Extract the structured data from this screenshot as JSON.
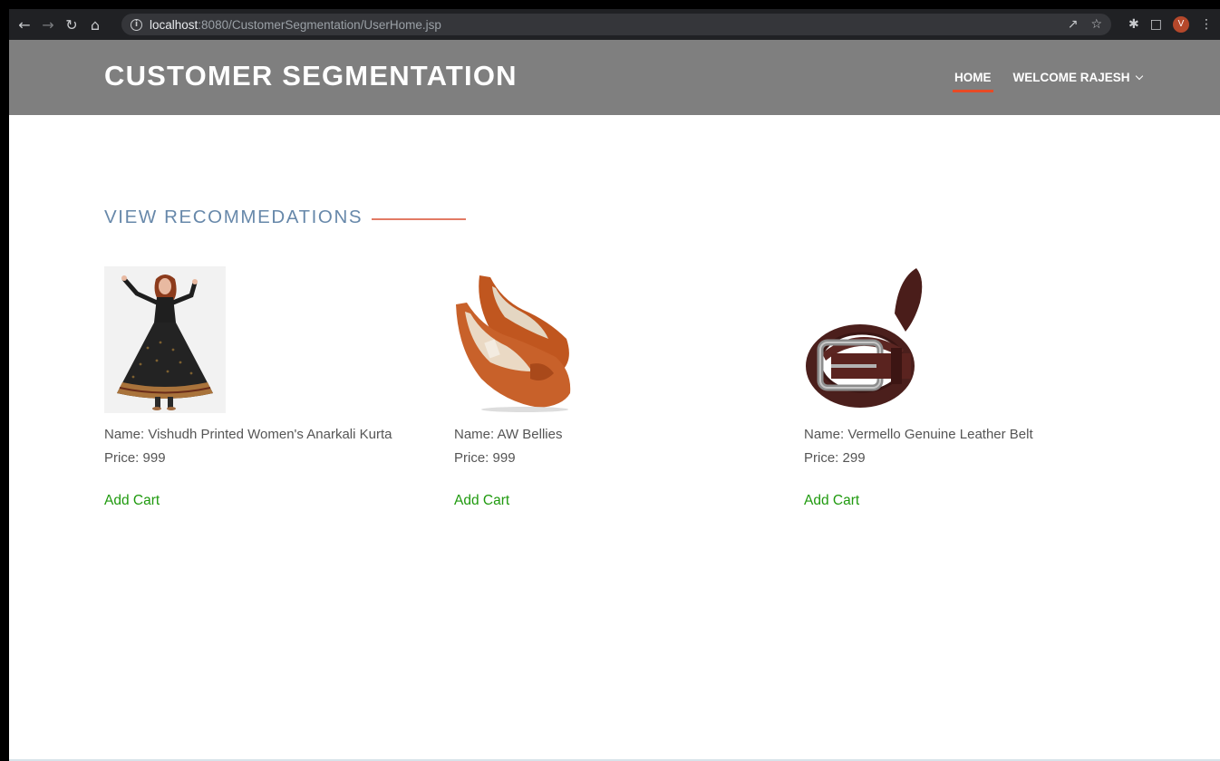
{
  "browser": {
    "url_host": "localhost",
    "url_rest": ":8080/CustomerSegmentation/UserHome.jsp",
    "profile_initial": "V",
    "icons": [
      "back-icon",
      "forward-icon",
      "reload-icon",
      "home-icon",
      "info-icon",
      "share-icon",
      "star-icon",
      "extensions-icon",
      "side-panel-icon",
      "menu-icon"
    ]
  },
  "header": {
    "brand": "CUSTOMER SEGMENTATION",
    "nav": {
      "home": "HOME",
      "welcome": "WELCOME RAJESH"
    },
    "accent_color": "#e84a25",
    "background_color": "#7f7f7f"
  },
  "main": {
    "section_title": "VIEW RECOMMEDATIONS",
    "products": [
      {
        "name": "Name: Vishudh Printed Women's Anarkali Kurta",
        "price": "Price: 999",
        "action": "Add Cart"
      },
      {
        "name": "Name: AW Bellies",
        "price": "Price: 999",
        "action": "Add Cart"
      },
      {
        "name": "Name: Vermello Genuine Leather Belt",
        "price": "Price: 299",
        "action": "Add Cart"
      }
    ],
    "link_color": "#1f9a0e"
  }
}
